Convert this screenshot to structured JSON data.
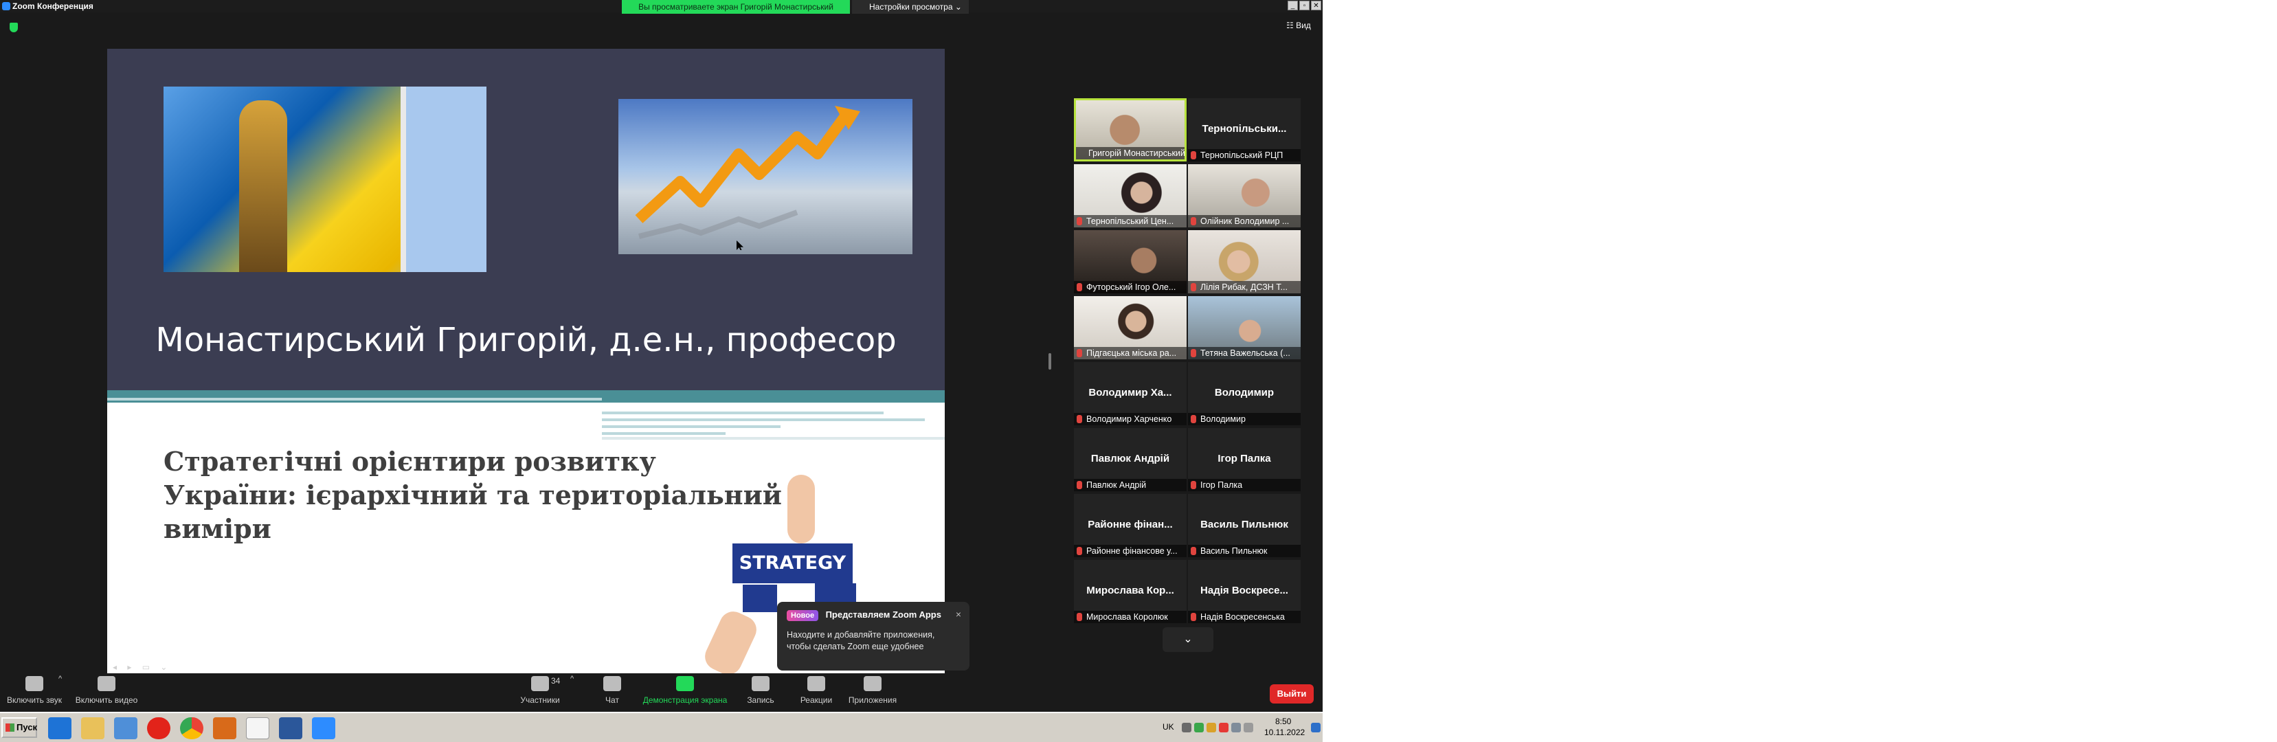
{
  "window": {
    "title": "Zoom Конференция",
    "share_banner": "Вы просматриваете экран Григорій Монастирський",
    "view_options": "Настройки просмотра ⌄",
    "view_label": "Вид",
    "controls": [
      "_",
      "▫",
      "✕"
    ]
  },
  "slide": {
    "name": "Монастирський Григорій, д.е.н., професор",
    "subtitle_lines": [
      "Стратегічні орієнтири розвитку",
      "України: ієрархічний та територіальний",
      "виміри"
    ],
    "puzzle_text": "STRATEGY"
  },
  "notification": {
    "badge": "Новое",
    "title": "Представляем Zoom Apps",
    "close": "×",
    "text": "Находите и добавляйте приложения, чтобы сделать Zoom еще удобнее"
  },
  "participants": [
    {
      "big_name": "",
      "caption": "Григорій Монастирський",
      "active": true,
      "photo": "man-headphones",
      "muted": false
    },
    {
      "big_name": "Тернопільськи...",
      "caption": "Тернопільський РЦП",
      "active": false,
      "photo": "",
      "muted": true
    },
    {
      "big_name": "",
      "caption": "Тернопільський Цен...",
      "active": false,
      "photo": "woman-dark-hair",
      "muted": true
    },
    {
      "big_name": "",
      "caption": "Олійник Володимир ...",
      "active": false,
      "photo": "man-office",
      "muted": true
    },
    {
      "big_name": "",
      "caption": "Футорський Ігор Оле...",
      "active": false,
      "photo": "man-dark-room",
      "muted": true
    },
    {
      "big_name": "",
      "caption": "Лілія Рибак, ДСЗН Т...",
      "active": false,
      "photo": "woman-blonde",
      "muted": true
    },
    {
      "big_name": "",
      "caption": "Підгаєцька міська ра...",
      "active": false,
      "photo": "woman-light-room",
      "muted": true
    },
    {
      "big_name": "",
      "caption": "Тетяна Важельська (...",
      "active": false,
      "photo": "woman-office",
      "muted": true
    },
    {
      "big_name": "Володимир Ха...",
      "caption": "Володимир Харченко",
      "active": false,
      "photo": "",
      "muted": true
    },
    {
      "big_name": "Володимир",
      "caption": "Володимир",
      "active": false,
      "photo": "",
      "muted": true
    },
    {
      "big_name": "Павлюк Андрій",
      "caption": "Павлюк Андрій",
      "active": false,
      "photo": "",
      "muted": true
    },
    {
      "big_name": "Ігор Палка",
      "caption": "Ігор Палка",
      "active": false,
      "photo": "",
      "muted": true
    },
    {
      "big_name": "Районне фінан...",
      "caption": "Районне фінансове у...",
      "active": false,
      "photo": "",
      "muted": true
    },
    {
      "big_name": "Василь Пильнюк",
      "caption": "Василь Пильнюк",
      "active": false,
      "photo": "",
      "muted": true
    },
    {
      "big_name": "Мирослава Кор...",
      "caption": "Мирослава Королюк",
      "active": false,
      "photo": "",
      "muted": true
    },
    {
      "big_name": "Надія Воскресе...",
      "caption": "Надія Воскресенська",
      "active": false,
      "photo": "",
      "muted": true
    }
  ],
  "more_participants": "⌄",
  "toolbar": {
    "unmute": "Включить звук",
    "start_video": "Включить видео",
    "participants": "Участники",
    "participants_count": "34",
    "chat": "Чат",
    "share_screen": "Демонстрация экрана",
    "record": "Запись",
    "reactions": "Реакции",
    "apps": "Приложения",
    "leave": "Выйти",
    "caret": "^"
  },
  "taskbar": {
    "start": "Пуск",
    "language": "UK",
    "time": "8:50",
    "date": "10.11.2022",
    "apps": [
      "ie-icon",
      "explorer-icon",
      "media-player-icon",
      "opera-icon",
      "chrome-icon",
      "app-icon",
      "document-icon",
      "word-icon",
      "zoom-icon"
    ]
  },
  "colors": {
    "share_green": "#23d959",
    "active_border": "#b7e23d",
    "leave_red": "#e02828",
    "slide_dark": "#3b3d52",
    "slide_teal": "#4a8f96"
  }
}
